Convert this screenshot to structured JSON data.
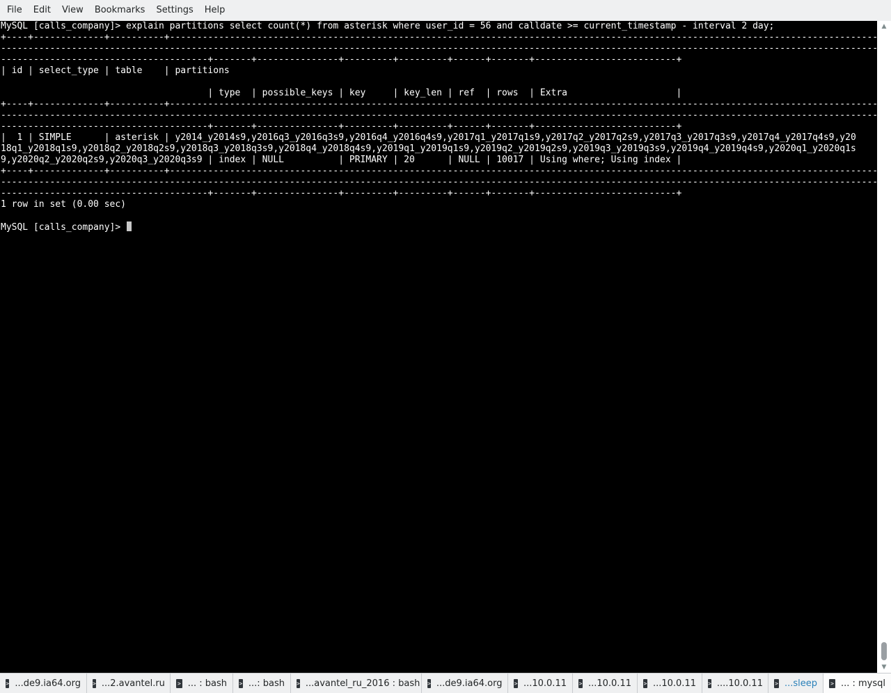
{
  "menubar": {
    "items": [
      "File",
      "Edit",
      "View",
      "Bookmarks",
      "Settings",
      "Help"
    ]
  },
  "terminal": {
    "lines": [
      "MySQL [calls_company]> explain partitions select count(*) from asterisk where user_id = 56 and calldate >= current_timestamp - interval 2 day;",
      "+----+-------------+----------+------------------------------------------------------------------------------------------------------------------------------------------------------------------------------------",
      "------------------------------------------------------------------------------------------------------------------------------------------------------------------------------------------",
      "--------------------------------------+-------+---------------+---------+---------+------+-------+--------------------------+",
      "| id | select_type | table    | partitions",
      "",
      "                                      | type  | possible_keys | key     | key_len | ref  | rows  | Extra                    |",
      "+----+-------------+----------+------------------------------------------------------------------------------------------------------------------------------------------------------------------------------------",
      "------------------------------------------------------------------------------------------------------------------------------------------------------------------------------------------",
      "--------------------------------------+-------+---------------+---------+---------+------+-------+--------------------------+",
      "|  1 | SIMPLE      | asterisk | y2014_y2014s9,y2016q3_y2016q3s9,y2016q4_y2016q4s9,y2017q1_y2017q1s9,y2017q2_y2017q2s9,y2017q3_y2017q3s9,y2017q4_y2017q4s9,y20",
      "18q1_y2018q1s9,y2018q2_y2018q2s9,y2018q3_y2018q3s9,y2018q4_y2018q4s9,y2019q1_y2019q1s9,y2019q2_y2019q2s9,y2019q3_y2019q3s9,y2019q4_y2019q4s9,y2020q1_y2020q1s",
      "9,y2020q2_y2020q2s9,y2020q3_y2020q3s9 | index | NULL          | PRIMARY | 20      | NULL | 10017 | Using where; Using index |",
      "+----+-------------+----------+------------------------------------------------------------------------------------------------------------------------------------------------------------------------------------",
      "------------------------------------------------------------------------------------------------------------------------------------------------------------------------------------------",
      "--------------------------------------+-------+---------------+---------+---------+------+-------+--------------------------+",
      "1 row in set (0.00 sec)",
      "",
      "MySQL [calls_company]> "
    ]
  },
  "tabs": [
    {
      "label": "...de9.ia64.org"
    },
    {
      "label": "...2.avantel.ru"
    },
    {
      "label": "... : bash"
    },
    {
      "label": "...: bash"
    },
    {
      "label": "...avantel_ru_2016 : bash"
    },
    {
      "label": "...de9.ia64.org"
    },
    {
      "label": "...10.0.11"
    },
    {
      "label": "...10.0.11"
    },
    {
      "label": "...10.0.11"
    },
    {
      "label": "....10.0.11"
    },
    {
      "label": "...sleep"
    },
    {
      "label": "... : mysql"
    }
  ],
  "icons": {
    "tab": "terminal-icon",
    "scroll_up": "arrow-up-icon",
    "scroll_down": "arrow-down-icon"
  },
  "colors": {
    "terminal_bg": "#000000",
    "terminal_fg": "#ffffff",
    "chrome_bg": "#eff0f1",
    "accent": "#2980b9"
  }
}
